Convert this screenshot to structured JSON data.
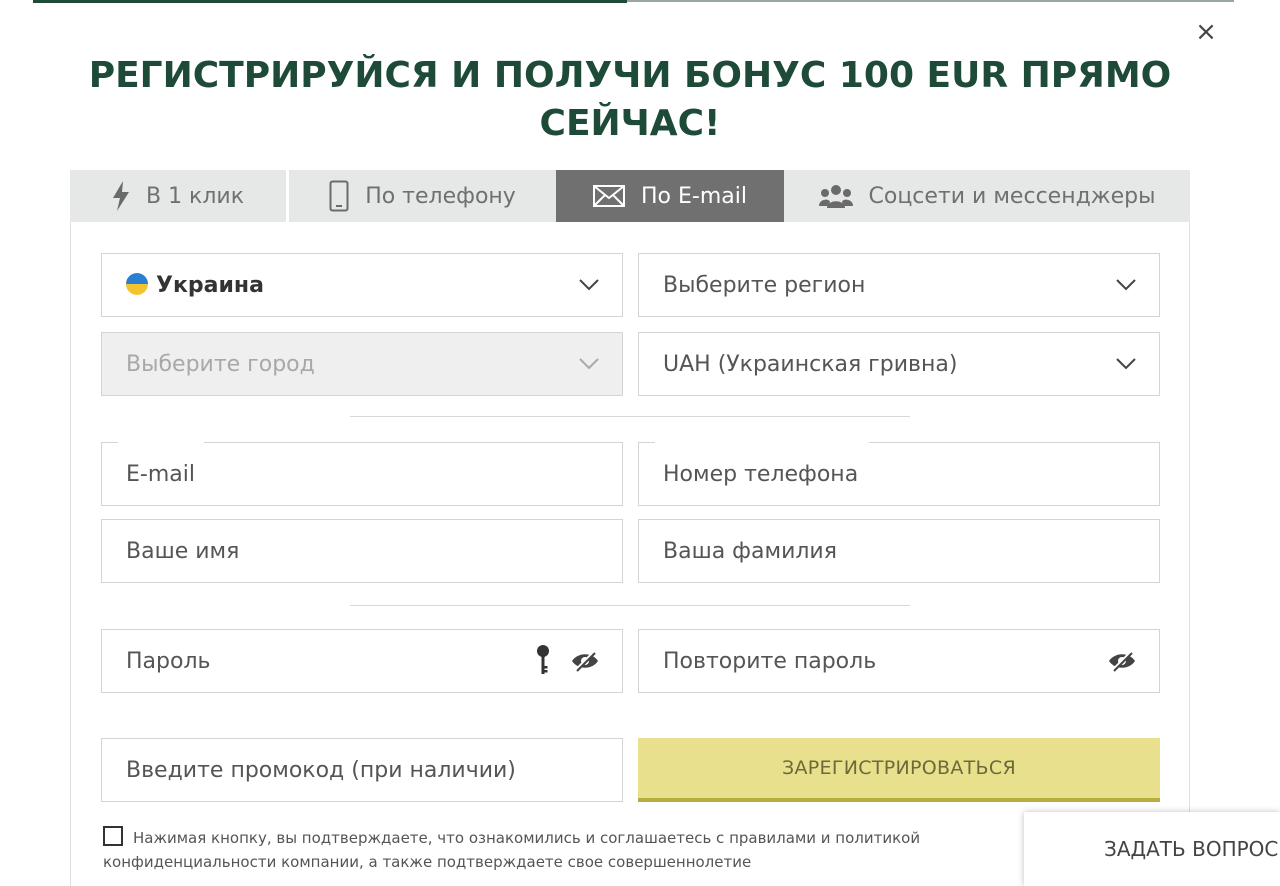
{
  "title": "РЕГИСТРИРУЙСЯ И ПОЛУЧИ БОНУС 100 EUR ПРЯМО СЕЙЧАС!",
  "close_label": "×",
  "tabs": [
    {
      "label": "В 1 клик",
      "icon": "lightning-icon"
    },
    {
      "label": "По телефону",
      "icon": "phone-icon"
    },
    {
      "label": "По E-mail",
      "icon": "envelope-icon",
      "active": true
    },
    {
      "label": "Соцсети и мессенджеры",
      "icon": "users-icon"
    }
  ],
  "fields": {
    "country": "Украина",
    "region": "Выберите регион",
    "city": "Выберите город",
    "currency": "UAH (Украинская гривна)",
    "email": "E-mail",
    "phone": "Номер телефона",
    "first_name": "Ваше имя",
    "last_name": "Ваша фамилия",
    "password": "Пароль",
    "password_repeat": "Повторите пароль",
    "promo": "Введите промокод (при наличии)"
  },
  "register_label": "ЗАРЕГИСТРИРОВАТЬСЯ",
  "consent": {
    "line1": "Нажимая кнопку, вы подтверждаете, что ознакомились и соглашаетесь с правилами и политикой",
    "line2": "конфиденциальности компании, а также подтверждаете свое совершеннолетие"
  },
  "ask_label": "ЗАДАТЬ ВОПРОС",
  "colors": {
    "title": "#1e4a38",
    "active_tab": "#707070",
    "register_button": "#e8e08c"
  }
}
